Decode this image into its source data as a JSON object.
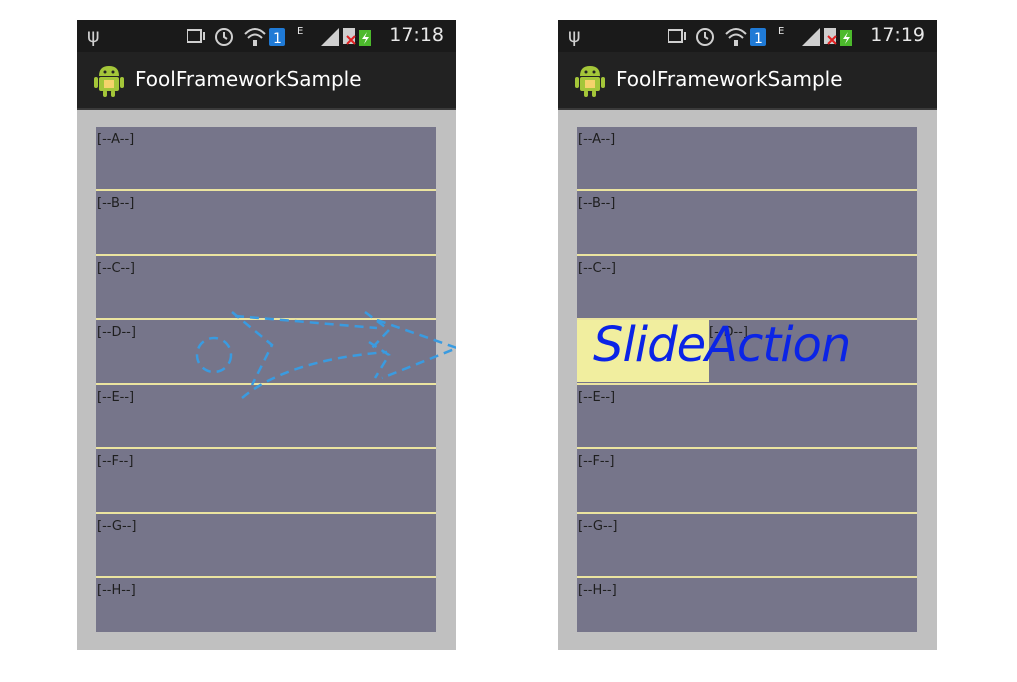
{
  "screens": [
    {
      "status": {
        "clock": "17:18",
        "network": "E"
      },
      "app_title": "FoolFrameworkSample",
      "rows": [
        "[--A--]",
        "[--B--]",
        "[--C--]",
        "[--D--]",
        "[--E--]",
        "[--F--]",
        "[--G--]",
        "[--H--]"
      ]
    },
    {
      "status": {
        "clock": "17:19",
        "network": "E"
      },
      "app_title": "FoolFrameworkSample",
      "rows": [
        "[--A--]",
        "[--B--]",
        "[--C--]",
        "[--D--]",
        "[--E--]",
        "[--F--]",
        "[--G--]",
        "[--H--]"
      ],
      "slide_action_label": "SlideAction"
    }
  ],
  "colors": {
    "list_background": "#76758a",
    "divider": "#ebe4a0",
    "slide_highlight": "#f1ee9f",
    "slide_text": "#0b24e6",
    "gesture_stroke": "#3a9be0"
  },
  "icons": [
    "usb-icon",
    "vibrate-icon",
    "alarm-icon",
    "wifi-icon",
    "notification-badge-icon",
    "signal-icon",
    "no-sim-icon",
    "battery-charging-icon",
    "android-logo-icon"
  ]
}
